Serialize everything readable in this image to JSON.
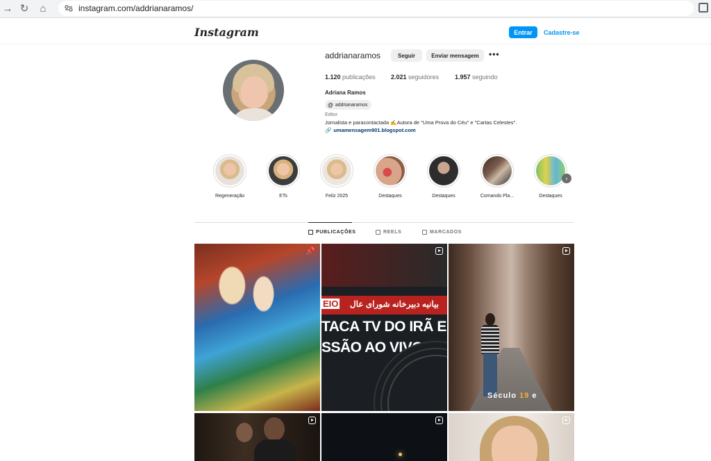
{
  "browser": {
    "url": "instagram.com/addrianaramos/"
  },
  "header": {
    "logo": "Instagram",
    "login_label": "Entrar",
    "signup_label": "Cadastre-se",
    "accent": "#0095f6"
  },
  "profile": {
    "username": "addrianaramos",
    "follow_label": "Seguir",
    "message_label": "Enviar mensagem",
    "more_label": "•••",
    "stats": [
      {
        "value": "1.120",
        "label": "publicações"
      },
      {
        "value": "2.021",
        "label": "seguidores"
      },
      {
        "value": "1.957",
        "label": "seguindo"
      }
    ],
    "full_name": "Adriana Ramos",
    "threads_handle": "addrianaramos",
    "category": "Editor",
    "bio": "Jornalista e paracontactada ✍️Autora de \"Uma Prova do Céu\" e \"Cartas Celestes\".",
    "link": "umamensagem901.blogspot.com"
  },
  "highlights": [
    {
      "label": "Regeneração"
    },
    {
      "label": "ETs"
    },
    {
      "label": "Feliz 2025"
    },
    {
      "label": "Destaques"
    },
    {
      "label": "Destaques"
    },
    {
      "label": "Comando Pla..."
    },
    {
      "label": "Destaques"
    }
  ],
  "tabs": [
    {
      "label": "PUBLICAÇÕES",
      "active": true
    },
    {
      "label": "REELS",
      "active": false
    },
    {
      "label": "MARCADOS",
      "active": false
    }
  ],
  "posts": {
    "p2_arabic": "بيانيه دبيرخانه شوراى عال",
    "p2_number": "EIO",
    "p2_line1": "TACA TV DO IRÃ EM",
    "p2_line2": "SSÃO AO VIVO",
    "p3_caption_a": "Século ",
    "p3_caption_b": "19",
    "p3_caption_c": " e"
  }
}
